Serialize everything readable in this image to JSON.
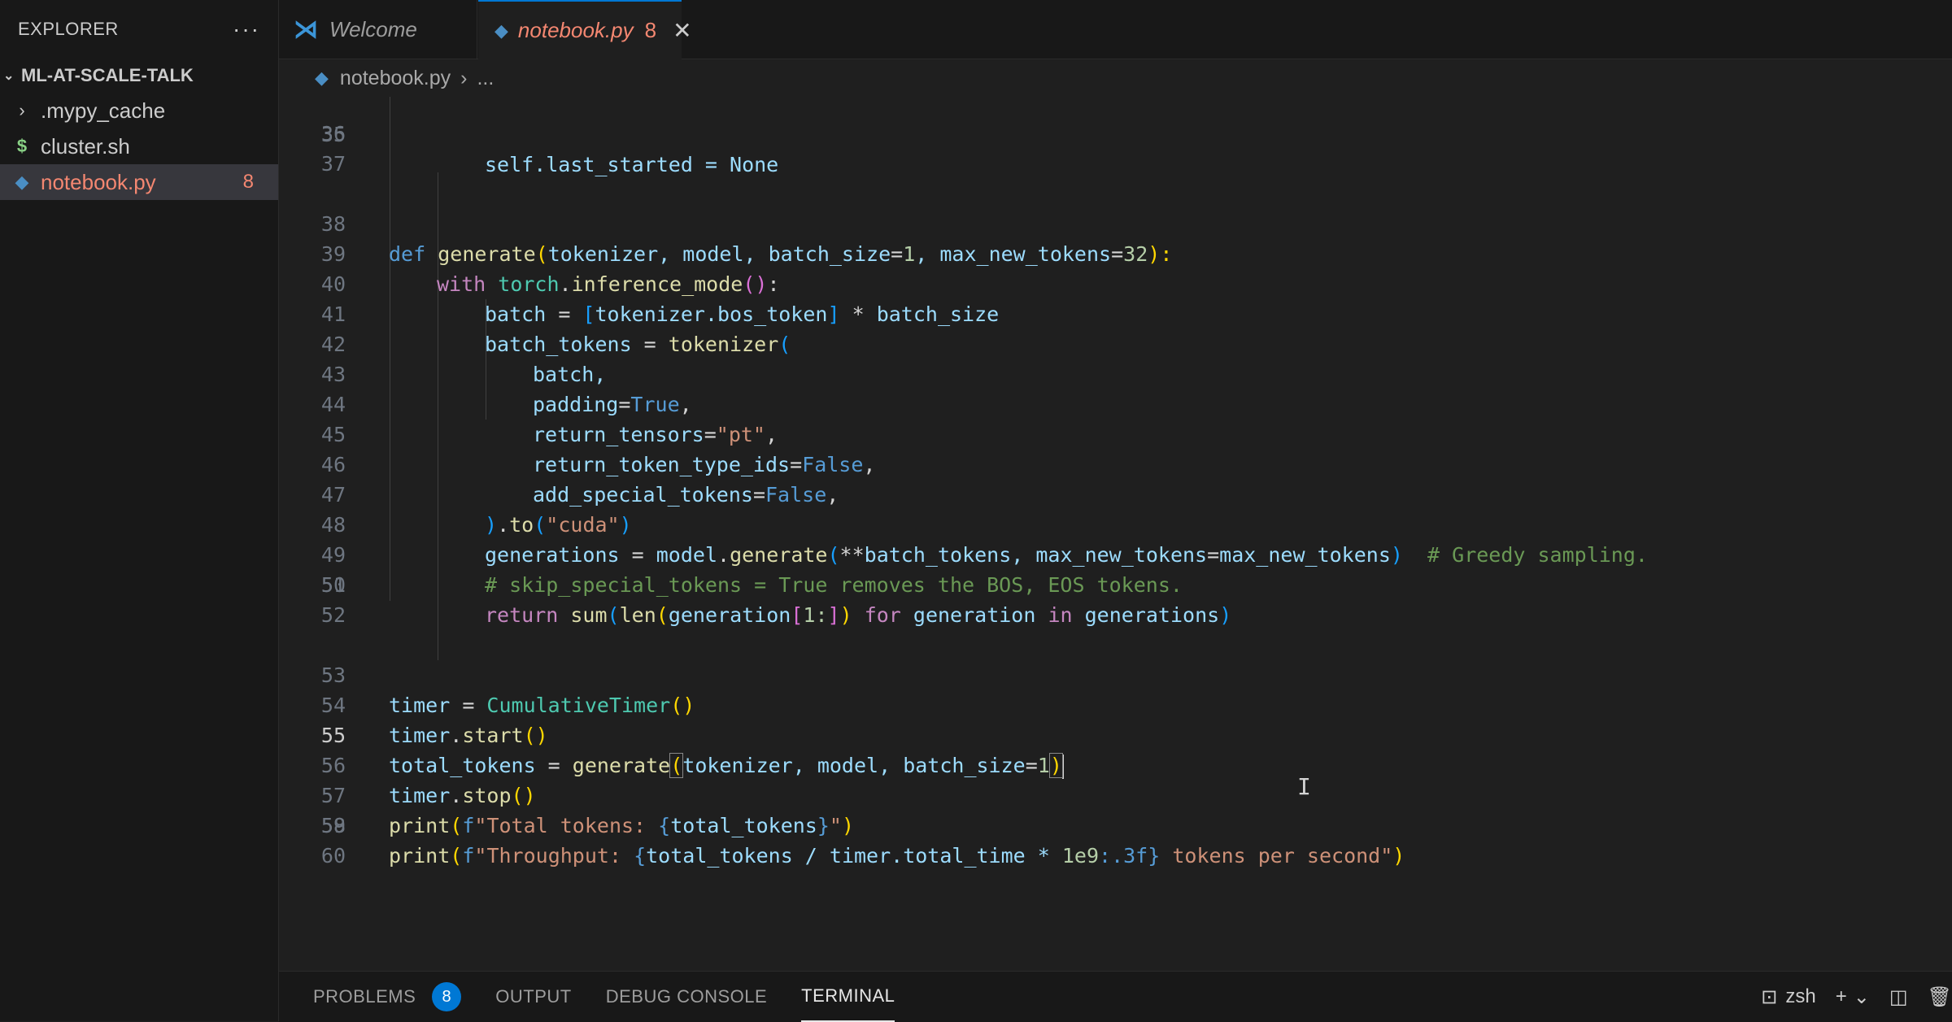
{
  "explorer": {
    "title": "EXPLORER",
    "more": "···",
    "root": "ML-AT-SCALE-TALK",
    "items": [
      {
        "label": ".mypy_cache",
        "icon": "chevron-right-icon"
      },
      {
        "label": "cluster.sh",
        "icon": "shell-script-icon"
      },
      {
        "label": "notebook.py",
        "icon": "python-file-icon",
        "count": "8"
      }
    ]
  },
  "tabs": [
    {
      "label": "Welcome",
      "icon": "vscode-logo-icon"
    },
    {
      "label": "notebook.py",
      "count": "8",
      "icon": "python-file-icon"
    }
  ],
  "breadcrumb": {
    "file": "notebook.py",
    "rest": "..."
  },
  "editor": {
    "line_numbers": [
      "35",
      "36",
      "37",
      "38",
      "39",
      "40",
      "41",
      "42",
      "43",
      "44",
      "45",
      "46",
      "47",
      "48",
      "49",
      "50",
      "51",
      "52",
      "53",
      "54",
      "55",
      "56",
      "57",
      "58",
      "59",
      "60"
    ],
    "current_line": "55",
    "partial_top_text": "self.last_started = None",
    "lines": {
      "l38": [
        "def",
        " ",
        "generate",
        "(",
        "tokenizer, model, batch_size",
        "=",
        "1",
        ", max_new_tokens",
        "=",
        "32",
        "):"
      ],
      "l39": [
        "with",
        " ",
        "torch",
        ".",
        "inference_mode",
        "",
        "()",
        ":"
      ],
      "l40": [
        "batch",
        " = ",
        "[",
        "tokenizer.bos_token",
        "]",
        " * ",
        "batch_size"
      ],
      "l41": [
        "batch_tokens",
        " = ",
        "tokenizer",
        "("
      ],
      "l42": [
        "batch,"
      ],
      "l43": [
        "padding",
        "=",
        "True",
        ","
      ],
      "l44": [
        "return_tensors",
        "=",
        "\"pt\"",
        ","
      ],
      "l45": [
        "return_token_type_ids",
        "=",
        "False",
        ","
      ],
      "l46": [
        "add_special_tokens",
        "=",
        "False",
        ","
      ],
      "l47": [
        ")",
        ".",
        "to",
        "(",
        "\"cuda\"",
        ")"
      ],
      "l48": [
        "generations",
        " = ",
        "model",
        ".",
        "generate",
        "(",
        "**",
        "batch_tokens, max_new_tokens",
        "=",
        "max_new_tokens",
        ")",
        "  # Greedy sampling."
      ],
      "l49": [
        "# skip_special_tokens = True removes the BOS, EOS tokens."
      ],
      "l50": [
        "return",
        " ",
        "sum",
        "(",
        "len",
        "(",
        "generation",
        "[",
        "1:",
        "]",
        ")",
        " ",
        "for",
        " generation ",
        "in",
        " generations",
        ")"
      ],
      "l53": [
        "timer",
        " = ",
        "CumulativeTimer",
        "()"
      ],
      "l54": [
        "timer",
        ".",
        "start",
        "()"
      ],
      "l55": [
        "total_tokens",
        " = ",
        "generate",
        "(",
        "tokenizer, model, batch_size",
        "=",
        "1",
        ")"
      ],
      "l56": [
        "timer",
        ".",
        "stop",
        "()"
      ],
      "l57": [
        "print",
        "(",
        "f",
        "\"Total tokens: ",
        "{",
        "total_tokens",
        "}",
        "\"",
        ")"
      ],
      "l58": [
        "print",
        "(",
        "f",
        "\"Throughput: ",
        "{",
        "total_tokens / timer.total_time * ",
        "1e9",
        ":.3f",
        "}",
        " tokens per second\"",
        ")"
      ]
    }
  },
  "panel": {
    "tabs": [
      {
        "label": "PROBLEMS",
        "badge": "8"
      },
      {
        "label": "OUTPUT"
      },
      {
        "label": "DEBUG CONSOLE"
      },
      {
        "label": "TERMINAL"
      }
    ],
    "shell": "zsh"
  },
  "colors": {
    "accent": "#0078d4",
    "error": "#f48771",
    "background": "#1f1f1f"
  }
}
